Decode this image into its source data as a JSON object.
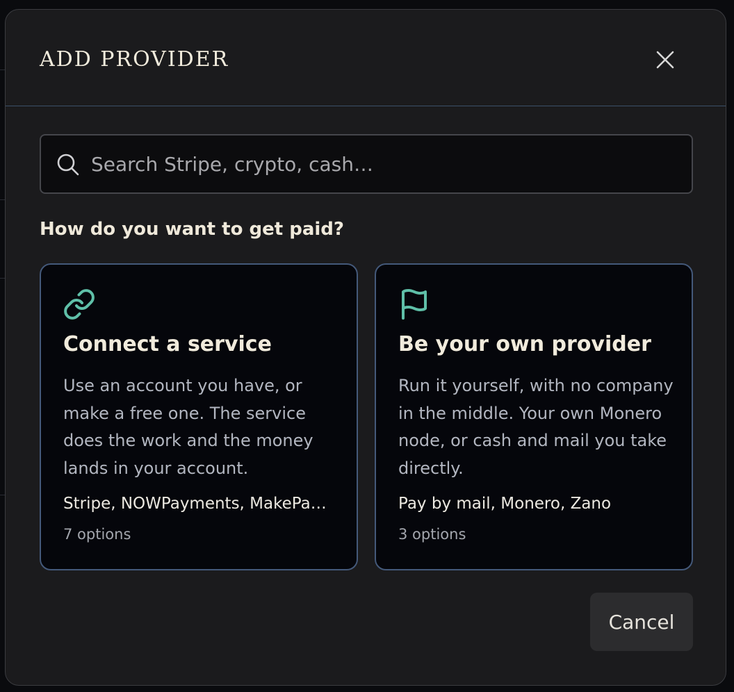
{
  "dialog": {
    "title": "ADD PROVIDER",
    "close_icon": "close-icon"
  },
  "search": {
    "placeholder": "Search Stripe, crypto, cash…",
    "value": "",
    "icon": "search-icon"
  },
  "prompt": "How do you want to get paid?",
  "options": [
    {
      "icon": "link-icon",
      "title": "Connect a service",
      "description": "Use an account you have, or make a free one. The service does the work and the money lands in your account.",
      "examples": "Stripe, NOWPayments, MakePay…",
      "count": "7 options"
    },
    {
      "icon": "flag-icon",
      "title": "Be your own provider",
      "description": "Run it yourself, with no company in the middle. Your own Monero node, or cash and mail you take directly.",
      "examples": "Pay by mail, Monero, Zano",
      "count": "3 options"
    }
  ],
  "footer": {
    "cancel_label": "Cancel"
  },
  "colors": {
    "accent_teal": "#5fbfa8",
    "card_border": "#44597a",
    "modal_background": "#1b1b1d",
    "card_background": "#05060b",
    "title_text": "#f1ebdc"
  }
}
